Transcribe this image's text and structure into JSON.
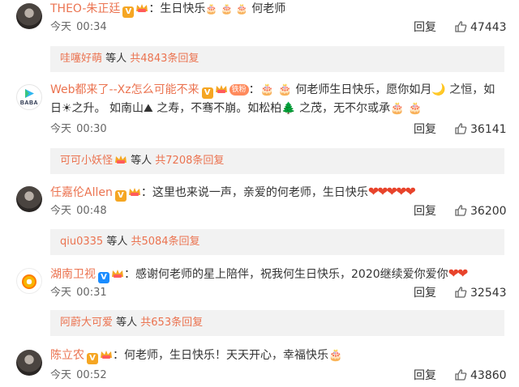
{
  "comments": [
    {
      "user": "THEO-朱正廷",
      "badges": [
        "v-badge",
        "crown-badge"
      ],
      "text": "：生日快乐",
      "emojis_after": "🎂 🎂 🎂",
      "text2": " 何老师",
      "date": "今天",
      "time": "00:34",
      "reply_label": "回复",
      "likes": "47443",
      "sub_user": "哇噻好萌",
      "sub_mid": " 等人 ",
      "sub_total": "共4843条回复"
    },
    {
      "user": "Web都来了--Xz怎么可能不来",
      "fan_label": "铁粉",
      "line1_text": "：🎂 🎂 何老师生日快乐，愿你如月🌙 之恒，如",
      "line2_text": "日☀之升。 如南山⛰ 之寿，不骞不崩。如松柏🌲 之茂，无不尔或承🎂 🎂",
      "date": "今天",
      "time": "00:30",
      "reply_label": "回复",
      "likes": "36141",
      "sub_user": "可可小妖怪",
      "sub_mid": " 等人 ",
      "sub_total": "共7208条回复"
    },
    {
      "user": "任嘉伦Allen",
      "text": "：这里也来说一声，亲爱的何老师，生日快乐",
      "hearts": "❤❤❤❤❤",
      "date": "今天",
      "time": "00:48",
      "reply_label": "回复",
      "likes": "36200",
      "sub_user": "qiu0335",
      "sub_mid": " 等人 ",
      "sub_total": "共5084条回复"
    },
    {
      "user": "湖南卫视",
      "text": "：感谢何老师的星上陪伴，祝我何生日快乐，2020继续爱你爱你",
      "hearts": "❤❤",
      "date": "今天",
      "time": "00:31",
      "reply_label": "回复",
      "likes": "32543",
      "sub_user": "阿蔚大可爱",
      "sub_mid": " 等人 ",
      "sub_total": "共653条回复"
    },
    {
      "user": "陈立农",
      "text": "：何老师，生日快乐！天天开心，幸福快乐",
      "emoji_end": "🎂",
      "date": "今天",
      "time": "00:52",
      "reply_label": "回复",
      "likes": "43860"
    }
  ],
  "avatars": {
    "c2_text": "BABA"
  },
  "colors": {
    "username": "#eb7350",
    "reply_box_bg": "#f2f2f2",
    "v_badge_gold": "#f5a623",
    "v_badge_blue": "#1a8cff"
  }
}
